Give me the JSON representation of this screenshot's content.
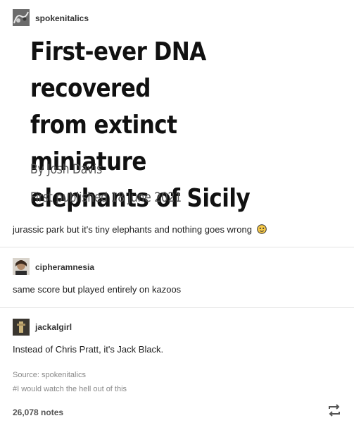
{
  "post1": {
    "username": "spokenitalics",
    "article": {
      "headline_lines": [
        "First-ever DNA recovered",
        "from extinct miniature",
        "elephants of Sicily"
      ],
      "byline": "By Josh Davis",
      "published": "First published 18 June 2021"
    },
    "caption": "jurassic park but it's tiny elephants and nothing goes wrong"
  },
  "reblog1": {
    "username": "cipheramnesia",
    "text": "same score but played entirely on kazoos"
  },
  "reblog2": {
    "username": "jackalgirl",
    "text": "Instead of Chris Pratt, it's Jack Black."
  },
  "footer": {
    "source": "Source: spokenitalics",
    "tag": "#I would watch the hell out of this",
    "notes": "26,078 notes"
  },
  "colors": {
    "text": "#222222",
    "muted": "#888888",
    "divider": "#e4e4e4"
  },
  "icons": [
    "avatar-image",
    "smiley-emoji",
    "reblog-icon"
  ]
}
